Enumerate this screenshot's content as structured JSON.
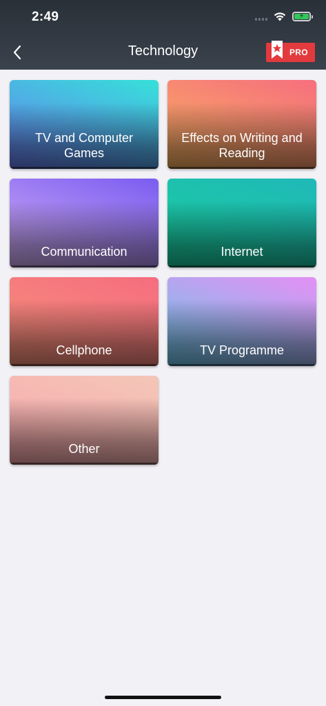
{
  "status_bar": {
    "time": "2:49"
  },
  "header": {
    "title": "Technology",
    "pro_label": "PRO"
  },
  "colors": {
    "header_bg": "#2f363f",
    "page_bg": "#f2f1f6",
    "pro_bg": "#e23a3d"
  },
  "categories": [
    {
      "label": "TV and Computer Games",
      "gradient": [
        "#6a7bf0",
        "#35e0d9"
      ]
    },
    {
      "label": "Effects on Writing and Reading",
      "gradient": [
        "#f8b35f",
        "#f66e7e"
      ]
    },
    {
      "label": "Communication",
      "gradient": [
        "#d6b2f7",
        "#7a5cf0"
      ]
    },
    {
      "label": "Internet",
      "gradient": [
        "#18cf9d",
        "#20b8b8"
      ]
    },
    {
      "label": "Cellphone",
      "gradient": [
        "#f8937a",
        "#f56d7f"
      ]
    },
    {
      "label": "TV Programme",
      "gradient": [
        "#6cc8e8",
        "#e48ff4"
      ]
    },
    {
      "label": "Other",
      "gradient": [
        "#f8a7ad",
        "#f4c6b7"
      ]
    }
  ]
}
